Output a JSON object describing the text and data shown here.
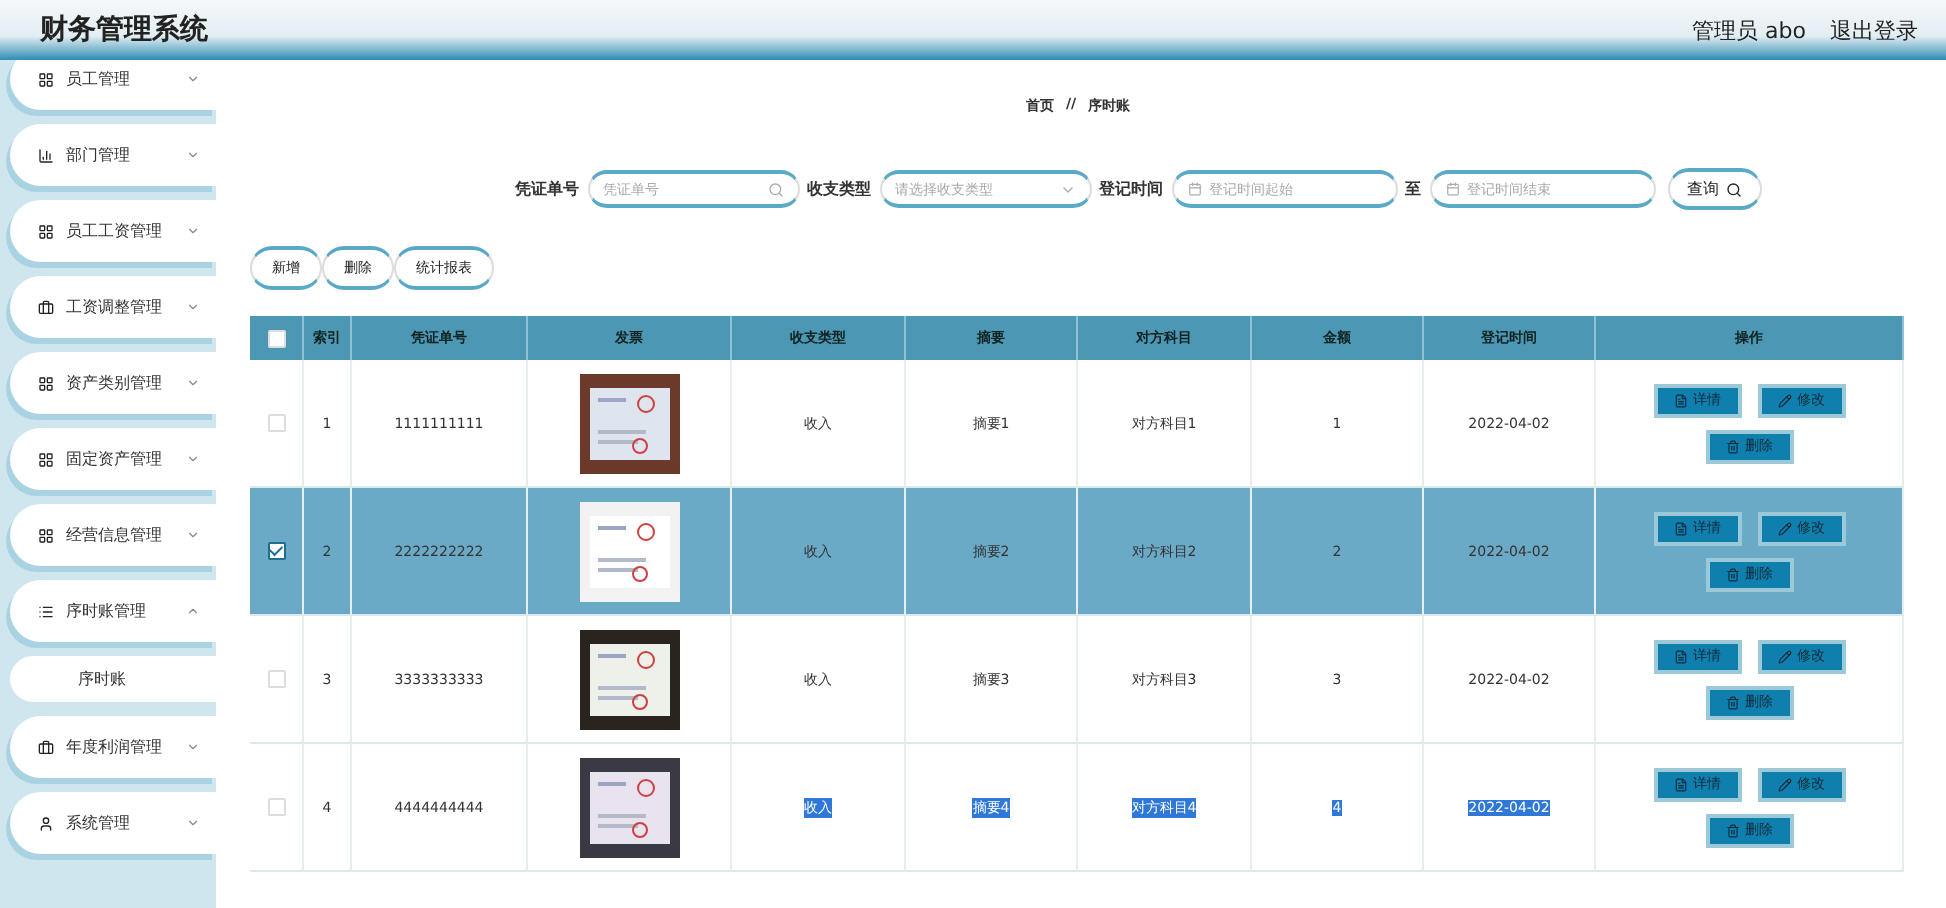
{
  "header": {
    "title": "财务管理系统",
    "user": "管理员 abo",
    "logout": "退出登录"
  },
  "sidebar": {
    "items": [
      {
        "label": "员工管理",
        "expanded": false
      },
      {
        "label": "部门管理",
        "expanded": false
      },
      {
        "label": "员工工资管理",
        "expanded": false
      },
      {
        "label": "工资调整管理",
        "expanded": false
      },
      {
        "label": "资产类别管理",
        "expanded": false
      },
      {
        "label": "固定资产管理",
        "expanded": false
      },
      {
        "label": "经营信息管理",
        "expanded": false
      },
      {
        "label": "序时账管理",
        "expanded": true,
        "children": [
          {
            "label": "序时账"
          }
        ]
      },
      {
        "label": "年度利润管理",
        "expanded": false
      },
      {
        "label": "系统管理",
        "expanded": false
      }
    ]
  },
  "breadcrumb": [
    "首页",
    "//",
    "序时账"
  ],
  "filters": [
    {
      "kind": "search",
      "label": "凭证单号",
      "placeholder": "凭证单号"
    },
    {
      "kind": "select",
      "label": "收支类型",
      "placeholder": "请选择收支类型"
    },
    {
      "kind": "date",
      "label": "登记时间",
      "placeholder": "登记时间起始"
    },
    {
      "kind": "date",
      "label": "至",
      "placeholder": "登记时间结束"
    }
  ],
  "search_button": "查询",
  "actions": [
    "新增",
    "删除",
    "统计报表"
  ],
  "table": {
    "columns": [
      "索引",
      "凭证单号",
      "发票",
      "收支类型",
      "摘要",
      "对方科目",
      "金额",
      "登记时间",
      "操作"
    ],
    "select_all": {
      "checked": false
    },
    "rows": [
      {
        "index": "1",
        "voucher": "1111111111",
        "invoice": {
          "kind": "picture"
        },
        "type": "收入",
        "summary": "摘要1",
        "account": "对方科目1",
        "amount": "1",
        "date": "2022-04-02",
        "selected": false,
        "text_selected": false,
        "buttons": [
          "详情",
          "修改",
          "删除"
        ]
      },
      {
        "index": "2",
        "voucher": "2222222222",
        "invoice": {
          "kind": "picture"
        },
        "type": "收入",
        "summary": "摘要2",
        "account": "对方科目2",
        "amount": "2",
        "date": "2022-04-02",
        "selected": true,
        "text_selected": false,
        "buttons": [
          "详情",
          "修改",
          "删除"
        ]
      },
      {
        "index": "3",
        "voucher": "3333333333",
        "invoice": {
          "kind": "picture"
        },
        "type": "收入",
        "summary": "摘要3",
        "account": "对方科目3",
        "amount": "3",
        "date": "2022-04-02",
        "selected": false,
        "text_selected": false,
        "buttons": [
          "详情",
          "修改",
          "删除"
        ]
      },
      {
        "index": "4",
        "voucher": "4444444444",
        "invoice": {
          "kind": "picture"
        },
        "type": "收入",
        "summary": "摘要4",
        "account": "对方科目4",
        "amount": "4",
        "date": "2022-04-02",
        "selected": false,
        "text_selected": true,
        "buttons": [
          "详情",
          "修改",
          "删除"
        ]
      }
    ]
  }
}
